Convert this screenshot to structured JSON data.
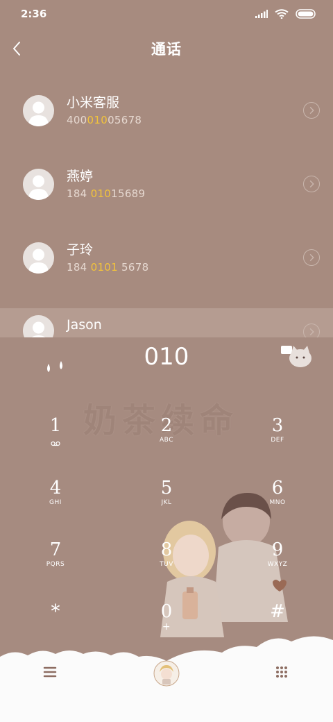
{
  "status": {
    "time": "2:36"
  },
  "header": {
    "title": "通话"
  },
  "contacts": [
    {
      "name": "小米客服",
      "num_a": "400",
      "num_hl": "010",
      "num_b": "05678"
    },
    {
      "name": "燕婷",
      "num_a": "184 ",
      "num_hl": "010",
      "num_b": "15689"
    },
    {
      "name": "子玲",
      "num_a": "184 ",
      "num_hl": "0101",
      "num_b": " 5678"
    },
    {
      "name": "Jason",
      "num_a": "",
      "num_hl": "",
      "num_b": ""
    }
  ],
  "dialer": {
    "input": "010",
    "watermark": "奶茶续命",
    "keys": [
      {
        "digit": "1",
        "letters": ""
      },
      {
        "digit": "2",
        "letters": "ABC"
      },
      {
        "digit": "3",
        "letters": "DEF"
      },
      {
        "digit": "4",
        "letters": "GHI"
      },
      {
        "digit": "5",
        "letters": "JKL"
      },
      {
        "digit": "6",
        "letters": "MNO"
      },
      {
        "digit": "7",
        "letters": "PQRS"
      },
      {
        "digit": "8",
        "letters": "TUV"
      },
      {
        "digit": "9",
        "letters": "WXYZ"
      },
      {
        "digit": "*",
        "letters": ""
      },
      {
        "digit": "0",
        "letters": "+"
      },
      {
        "digit": "#",
        "letters": ""
      }
    ]
  },
  "colors": {
    "background": "#a78b7f",
    "highlight": "#f2c33b",
    "bottom": "#fbfbfb"
  },
  "icons": [
    "back-icon",
    "signal-icon",
    "wifi-icon",
    "battery-icon",
    "chevron-right-icon",
    "voicemail-icon",
    "menu-icon",
    "dialpad-icon",
    "call-icon"
  ]
}
